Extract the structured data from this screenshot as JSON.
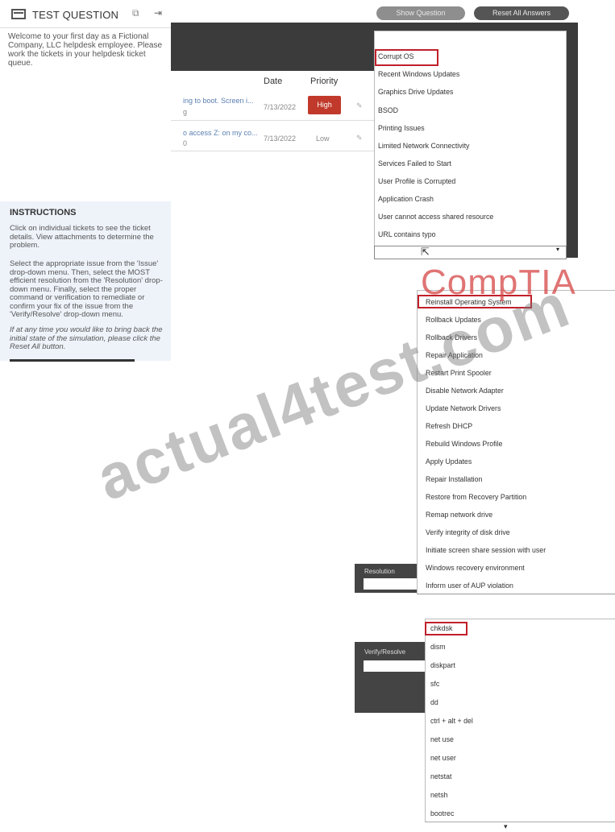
{
  "test_question": {
    "title": "TEST QUESTION",
    "popout_icon": "popout-icon",
    "collapse_icon": "collapse-icon",
    "welcome": "Welcome to your first day as a Fictional Company, LLC helpdesk employee. Please work the tickets in your helpdesk ticket queue.",
    "instructions_title": "INSTRUCTIONS",
    "instructions_p1": "Click on individual tickets to see the ticket details. View attachments to determine the problem.",
    "instructions_p2": "Select the appropriate issue from the 'Issue' drop-down menu. Then, select the MOST efficient resolution from the 'Resolution' drop-down menu. Finally, select the proper command or verification to remediate or confirm your fix of the issue from the 'Verify/Resolve' drop-down menu.",
    "instructions_p3": "If at any time you would like to bring back the initial state of the simulation, please click the Reset All button."
  },
  "toolbar": {
    "show_question": "Show Question",
    "reset_all": "Reset All Answers"
  },
  "tickets": {
    "headers": {
      "date": "Date",
      "priority": "Priority"
    },
    "rows": [
      {
        "subject": "ing to boot. Screen i...",
        "sub2": "g",
        "date": "7/13/2022",
        "priority": "High"
      },
      {
        "subject": "o access Z: on my co...",
        "sub2": "0",
        "date": "7/13/2022",
        "priority": "Low"
      }
    ]
  },
  "issue_dropdown": {
    "options": [
      "Corrupt OS",
      "Recent Windows Updates",
      "Graphics Drive Updates",
      "BSOD",
      "Printing Issues",
      "Limited Network Connectivity",
      "Services Failed to Start",
      "User Profile is Corrupted",
      "Application Crash",
      "User cannot access shared resource",
      "URL contains typo"
    ],
    "selected": "Corrupt OS"
  },
  "resolution_dropdown": {
    "label": "Resolution",
    "options": [
      "Reinstall Operating System",
      "Rollback Updates",
      "Rollback Drivers",
      "Repair Application",
      "Restart Print Spooler",
      "Disable Network Adapter",
      "Update Network Drivers",
      "Refresh DHCP",
      "Rebuild Windows Profile",
      "Apply Updates",
      "Repair Installation",
      "Restore from Recovery Partition",
      "Remap network drive",
      "Verify integrity of disk drive",
      "Initiate screen share session with user",
      "Windows recovery environment",
      "Inform user of AUP violation"
    ],
    "selected": "Reinstall Operating System"
  },
  "verify_dropdown": {
    "label": "Verify/Resolve",
    "options": [
      "chkdsk",
      "dism",
      "diskpart",
      "sfc",
      "dd",
      "ctrl + alt + del",
      "net use",
      "net user",
      "netstat",
      "netsh",
      "bootrec"
    ],
    "selected": "chkdsk"
  },
  "watermarks": {
    "comptia": "CompTIA",
    "site": "actual4test.com"
  },
  "colors": {
    "high_priority": "#c0392b",
    "highlight": "#c0202a",
    "dark_bg": "#3b3b3b"
  }
}
